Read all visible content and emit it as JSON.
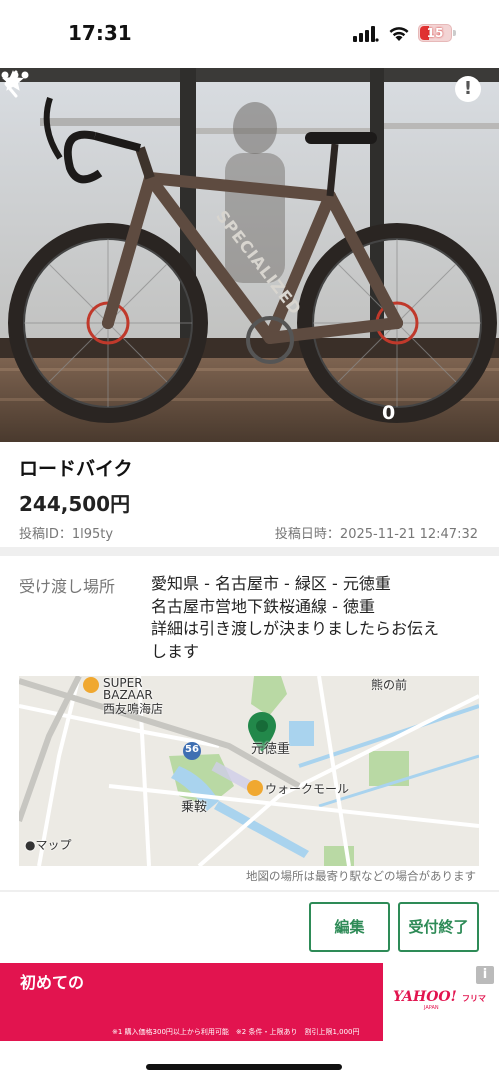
{
  "status_bar": {
    "time": "17:31",
    "battery": "15",
    "battery_color": "#e03131"
  },
  "photo": {
    "favorite_count": "0",
    "icons": [
      "back-icon",
      "report-icon",
      "star-icon",
      "more-icon"
    ]
  },
  "item": {
    "title": "ロードバイク",
    "price": "244,500円",
    "post_id": "投稿ID：1l95ty",
    "post_date": "投稿日時：2025-11-21 12:47:32"
  },
  "pickup": {
    "label": "受け渡し場所",
    "lines": [
      "愛知県 - 名古屋市 - 緑区 - 元徳重",
      "名古屋市営地下鉄桜通線 - 徳重",
      "詳細は引き渡しが決まりましたらお伝え",
      "します"
    ]
  },
  "map": {
    "labels": {
      "store_line1": "SUPER",
      "store_line2": "BAZAAR",
      "store_line3": "西友鳴海店",
      "route_number": "56",
      "station": "元徳重",
      "mall": "ウォークモール",
      "area": "乗鞍",
      "attribution": "マップ",
      "top_right": "熊の前"
    },
    "note": "地図の場所は最寄り駅などの場合があります",
    "pin_color": "#22884a"
  },
  "actions": {
    "edit": "編集",
    "close": "受付終了",
    "accent": "#2e8b57"
  },
  "ad": {
    "headline": "初めての",
    "fine_print": "※1 購入価格300円以上から利用可能　※2 条件・上限あり　割引上限1,000円",
    "brand": "YAHOO!",
    "brand_sub": "フリマ",
    "brand_japan": "JAPAN",
    "info": "i",
    "color": "#e2144f"
  }
}
